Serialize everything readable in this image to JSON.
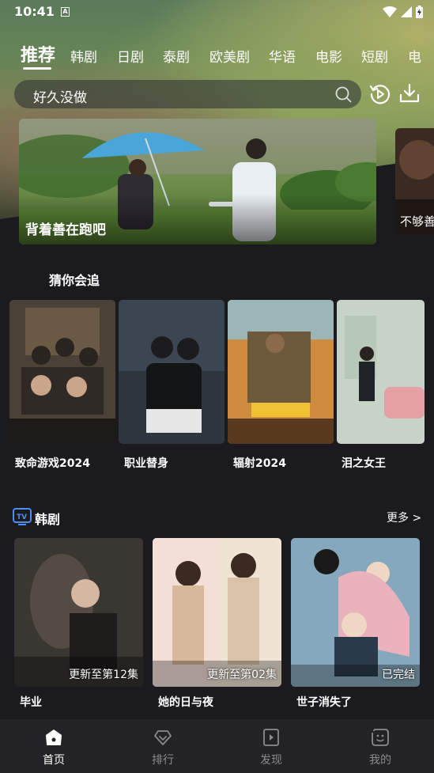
{
  "status_bar": {
    "time": "10:41",
    "notification_letter": "A"
  },
  "tabs": [
    {
      "label": "推荐",
      "active": true
    },
    {
      "label": "韩剧"
    },
    {
      "label": "日剧"
    },
    {
      "label": "泰剧"
    },
    {
      "label": "欧美剧"
    },
    {
      "label": "华语"
    },
    {
      "label": "电影"
    },
    {
      "label": "短剧"
    },
    {
      "label": "电"
    }
  ],
  "search": {
    "value": "好久没做",
    "icon": "search-icon"
  },
  "header_actions": [
    "history-icon",
    "download-icon"
  ],
  "banners": [
    {
      "title": "背着善在跑吧"
    },
    {
      "title": "不够善"
    }
  ],
  "guess_section": {
    "title": "猜你会追",
    "items": [
      {
        "name": "致命游戏2024"
      },
      {
        "name": "职业替身"
      },
      {
        "name": "辐射2024"
      },
      {
        "name": "泪之女王"
      }
    ]
  },
  "korean_section": {
    "title": "韩剧",
    "more": "更多 >",
    "items": [
      {
        "name": "毕业",
        "status": "更新至第12集"
      },
      {
        "name": "她的日与夜",
        "status": "更新至第02集"
      },
      {
        "name": "世子消失了",
        "status": "已完结"
      }
    ]
  },
  "bottom_nav": [
    {
      "label": "首页",
      "active": true
    },
    {
      "label": "排行"
    },
    {
      "label": "发现"
    },
    {
      "label": "我的"
    }
  ],
  "colors": {
    "background": "#1a1a1f",
    "nav_background": "#232326",
    "inactive": "#8a8a8f"
  }
}
